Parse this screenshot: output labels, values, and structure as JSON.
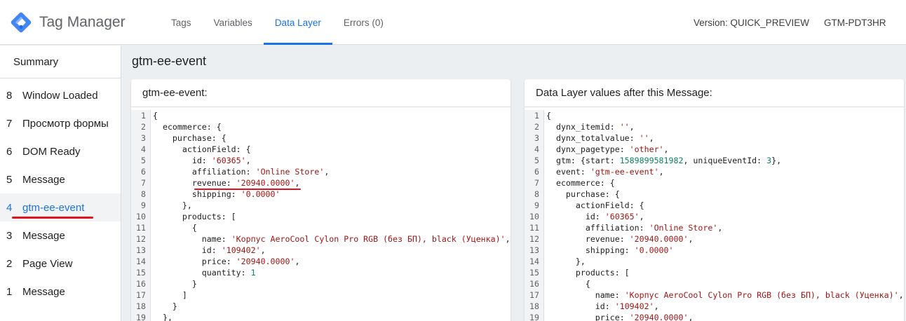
{
  "header": {
    "brand": "Tag Manager",
    "tabs": [
      {
        "label": "Tags",
        "active": false
      },
      {
        "label": "Variables",
        "active": false
      },
      {
        "label": "Data Layer",
        "active": true
      },
      {
        "label": "Errors (0)",
        "active": false
      }
    ],
    "version": "Version: QUICK_PREVIEW",
    "container_id": "GTM-PDT3HR"
  },
  "sidebar": {
    "summary_label": "Summary",
    "items": [
      {
        "num": "8",
        "label": "Window Loaded"
      },
      {
        "num": "7",
        "label": "Просмотр формы"
      },
      {
        "num": "6",
        "label": "DOM Ready"
      },
      {
        "num": "5",
        "label": "Message"
      },
      {
        "num": "4",
        "label": "gtm-ee-event",
        "active": true
      },
      {
        "num": "3",
        "label": "Message"
      },
      {
        "num": "2",
        "label": "Page View"
      },
      {
        "num": "1",
        "label": "Message"
      }
    ]
  },
  "main": {
    "title": "gtm-ee-event",
    "left_panel": {
      "title": "gtm-ee-event:",
      "lines": [
        "{",
        "  ecommerce: {",
        "    purchase: {",
        "      actionField: {",
        "        id: '60365',",
        "        affiliation: 'Online Store',",
        "        revenue: '20940.0000',",
        "        shipping: '0.0000'",
        "      },",
        "      products: [",
        "        {",
        "          name: 'Корпус AeroCool Cylon Pro RGB (без БП), black (Уценка)',",
        "          id: '109402',",
        "          price: '20940.0000',",
        "          quantity: 1",
        "        }",
        "      ]",
        "    }",
        "  },"
      ]
    },
    "right_panel": {
      "title": "Data Layer values after this Message:",
      "lines": [
        "{",
        "  dynx_itemid: '',",
        "  dynx_totalvalue: '',",
        "  dynx_pagetype: 'other',",
        "  gtm: {start: 1589899581982, uniqueEventId: 3},",
        "  event: 'gtm-ee-event',",
        "  ecommerce: {",
        "    purchase: {",
        "      actionField: {",
        "        id: '60365',",
        "        affiliation: 'Online Store',",
        "        revenue: '20940.0000',",
        "        shipping: '0.0000'",
        "      },",
        "      products: [",
        "        {",
        "          name: 'Корпус AeroCool Cylon Pro RGB (без БП), black (Уценка)',",
        "          id: '109402',",
        "          price: '20940.0000',"
      ]
    }
  },
  "colors": {
    "accent": "#1a73e8",
    "highlight_underline": "#e0121f",
    "string": "#a31515",
    "number": "#098658"
  },
  "icons": {
    "logo": "gtm-diamond-logo-icon"
  }
}
